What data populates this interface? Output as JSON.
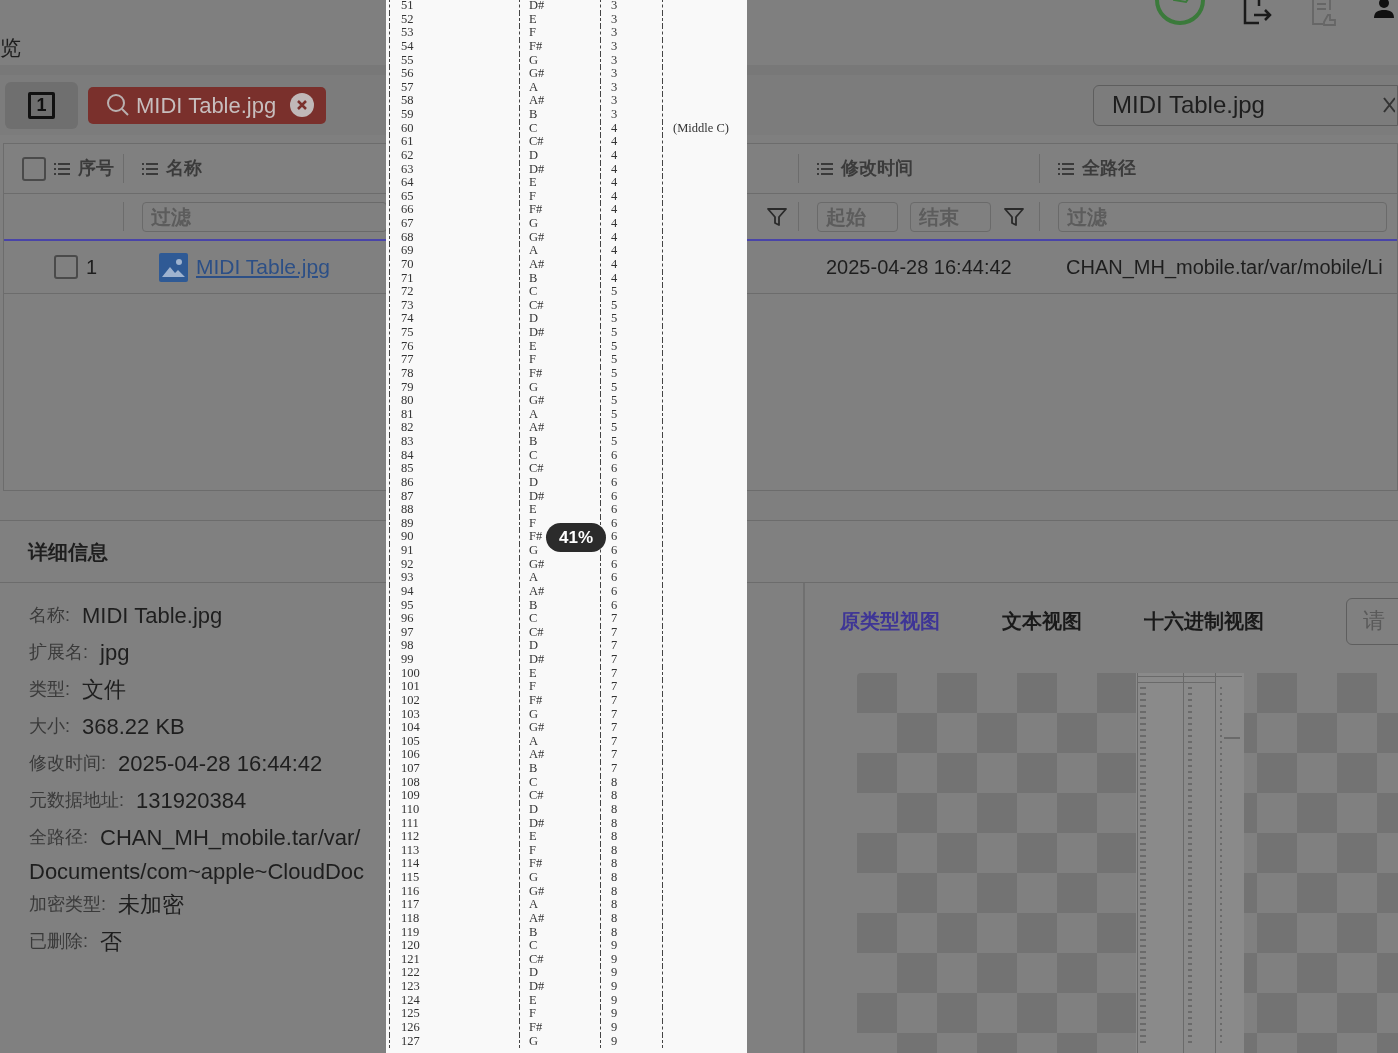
{
  "top_bar": {
    "title_fragment": "览"
  },
  "toolbar": {
    "count_button": "1",
    "search_tag": {
      "label": "MIDI Table.jpg"
    },
    "search_field": {
      "value": "MIDI Table.jpg"
    }
  },
  "table": {
    "select_all_checked": false,
    "columns": [
      {
        "label": "序号",
        "filter": {
          "kind": "none"
        }
      },
      {
        "label": "名称",
        "filter": {
          "kind": "text",
          "placeholder": "过滤"
        }
      },
      {
        "label": "修改时间",
        "filter": {
          "kind": "range",
          "start_placeholder": "起始",
          "end_placeholder": "结束"
        }
      },
      {
        "label": "全路径",
        "filter": {
          "kind": "text",
          "placeholder": "过滤"
        }
      }
    ],
    "rows": [
      {
        "checked": false,
        "index": "1",
        "name": "MIDI Table.jpg",
        "modified": "2025-04-28 16:44:42",
        "path": "CHAN_MH_mobile.tar/var/mobile/Li"
      }
    ]
  },
  "details": {
    "title": "详细信息",
    "fields": [
      {
        "label": "名称:",
        "value": "MIDI Table.jpg"
      },
      {
        "label": "扩展名:",
        "value": "jpg"
      },
      {
        "label": "类型:",
        "value": "文件"
      },
      {
        "label": "大小:",
        "value": "368.22 KB"
      },
      {
        "label": "修改时间:",
        "value": "2025-04-28 16:44:42"
      },
      {
        "label": "元数据地址:",
        "value": "131920384"
      },
      {
        "label": "全路径:",
        "value": "CHAN_MH_mobile.tar/var/",
        "continuation": "Documents/com~apple~CloudDoc"
      },
      {
        "label": "加密类型:",
        "value": "未加密"
      },
      {
        "label": "已删除:",
        "value": "否"
      }
    ]
  },
  "preview": {
    "tabs": [
      {
        "label": "原类型视图",
        "selected": true
      },
      {
        "label": "文本视图",
        "selected": false
      },
      {
        "label": "十六进制视图",
        "selected": false
      }
    ],
    "search": {
      "placeholder": "请"
    }
  },
  "image_viewer": {
    "zoom_badge": "41%",
    "rows": [
      {
        "number": "51",
        "note": "D#",
        "octave": "3"
      },
      {
        "number": "52",
        "note": "E",
        "octave": "3"
      },
      {
        "number": "53",
        "note": "F",
        "octave": "3"
      },
      {
        "number": "54",
        "note": "F#",
        "octave": "3"
      },
      {
        "number": "55",
        "note": "G",
        "octave": "3"
      },
      {
        "number": "56",
        "note": "G#",
        "octave": "3"
      },
      {
        "number": "57",
        "note": "A",
        "octave": "3"
      },
      {
        "number": "58",
        "note": "A#",
        "octave": "3"
      },
      {
        "number": "59",
        "note": "B",
        "octave": "3"
      },
      {
        "number": "60",
        "note": "C",
        "octave": "4",
        "remark": "(Middle C)"
      },
      {
        "number": "61",
        "note": "C#",
        "octave": "4"
      },
      {
        "number": "62",
        "note": "D",
        "octave": "4"
      },
      {
        "number": "63",
        "note": "D#",
        "octave": "4"
      },
      {
        "number": "64",
        "note": "E",
        "octave": "4"
      },
      {
        "number": "65",
        "note": "F",
        "octave": "4"
      },
      {
        "number": "66",
        "note": "F#",
        "octave": "4"
      },
      {
        "number": "67",
        "note": "G",
        "octave": "4"
      },
      {
        "number": "68",
        "note": "G#",
        "octave": "4"
      },
      {
        "number": "69",
        "note": "A",
        "octave": "4"
      },
      {
        "number": "70",
        "note": "A#",
        "octave": "4"
      },
      {
        "number": "71",
        "note": "B",
        "octave": "4"
      },
      {
        "number": "72",
        "note": "C",
        "octave": "5"
      },
      {
        "number": "73",
        "note": "C#",
        "octave": "5"
      },
      {
        "number": "74",
        "note": "D",
        "octave": "5"
      },
      {
        "number": "75",
        "note": "D#",
        "octave": "5"
      },
      {
        "number": "76",
        "note": "E",
        "octave": "5"
      },
      {
        "number": "77",
        "note": "F",
        "octave": "5"
      },
      {
        "number": "78",
        "note": "F#",
        "octave": "5"
      },
      {
        "number": "79",
        "note": "G",
        "octave": "5"
      },
      {
        "number": "80",
        "note": "G#",
        "octave": "5"
      },
      {
        "number": "81",
        "note": "A",
        "octave": "5"
      },
      {
        "number": "82",
        "note": "A#",
        "octave": "5"
      },
      {
        "number": "83",
        "note": "B",
        "octave": "5"
      },
      {
        "number": "84",
        "note": "C",
        "octave": "6"
      },
      {
        "number": "85",
        "note": "C#",
        "octave": "6"
      },
      {
        "number": "86",
        "note": "D",
        "octave": "6"
      },
      {
        "number": "87",
        "note": "D#",
        "octave": "6"
      },
      {
        "number": "88",
        "note": "E",
        "octave": "6"
      },
      {
        "number": "89",
        "note": "F",
        "octave": "6"
      },
      {
        "number": "90",
        "note": "F#",
        "octave": "6"
      },
      {
        "number": "91",
        "note": "G",
        "octave": "6"
      },
      {
        "number": "92",
        "note": "G#",
        "octave": "6"
      },
      {
        "number": "93",
        "note": "A",
        "octave": "6"
      },
      {
        "number": "94",
        "note": "A#",
        "octave": "6"
      },
      {
        "number": "95",
        "note": "B",
        "octave": "6"
      },
      {
        "number": "96",
        "note": "C",
        "octave": "7"
      },
      {
        "number": "97",
        "note": "C#",
        "octave": "7"
      },
      {
        "number": "98",
        "note": "D",
        "octave": "7"
      },
      {
        "number": "99",
        "note": "D#",
        "octave": "7"
      },
      {
        "number": "100",
        "note": "E",
        "octave": "7"
      },
      {
        "number": "101",
        "note": "F",
        "octave": "7"
      },
      {
        "number": "102",
        "note": "F#",
        "octave": "7"
      },
      {
        "number": "103",
        "note": "G",
        "octave": "7"
      },
      {
        "number": "104",
        "note": "G#",
        "octave": "7"
      },
      {
        "number": "105",
        "note": "A",
        "octave": "7"
      },
      {
        "number": "106",
        "note": "A#",
        "octave": "7"
      },
      {
        "number": "107",
        "note": "B",
        "octave": "7"
      },
      {
        "number": "108",
        "note": "C",
        "octave": "8"
      },
      {
        "number": "109",
        "note": "C#",
        "octave": "8"
      },
      {
        "number": "110",
        "note": "D",
        "octave": "8"
      },
      {
        "number": "111",
        "note": "D#",
        "octave": "8"
      },
      {
        "number": "112",
        "note": "E",
        "octave": "8"
      },
      {
        "number": "113",
        "note": "F",
        "octave": "8"
      },
      {
        "number": "114",
        "note": "F#",
        "octave": "8"
      },
      {
        "number": "115",
        "note": "G",
        "octave": "8"
      },
      {
        "number": "116",
        "note": "G#",
        "octave": "8"
      },
      {
        "number": "117",
        "note": "A",
        "octave": "8"
      },
      {
        "number": "118",
        "note": "A#",
        "octave": "8"
      },
      {
        "number": "119",
        "note": "B",
        "octave": "8"
      },
      {
        "number": "120",
        "note": "C",
        "octave": "9"
      },
      {
        "number": "121",
        "note": "C#",
        "octave": "9"
      },
      {
        "number": "122",
        "note": "D",
        "octave": "9"
      },
      {
        "number": "123",
        "note": "D#",
        "octave": "9"
      },
      {
        "number": "124",
        "note": "E",
        "octave": "9"
      },
      {
        "number": "125",
        "note": "F",
        "octave": "9"
      },
      {
        "number": "126",
        "note": "F#",
        "octave": "9"
      },
      {
        "number": "127",
        "note": "G",
        "octave": "9"
      }
    ]
  }
}
